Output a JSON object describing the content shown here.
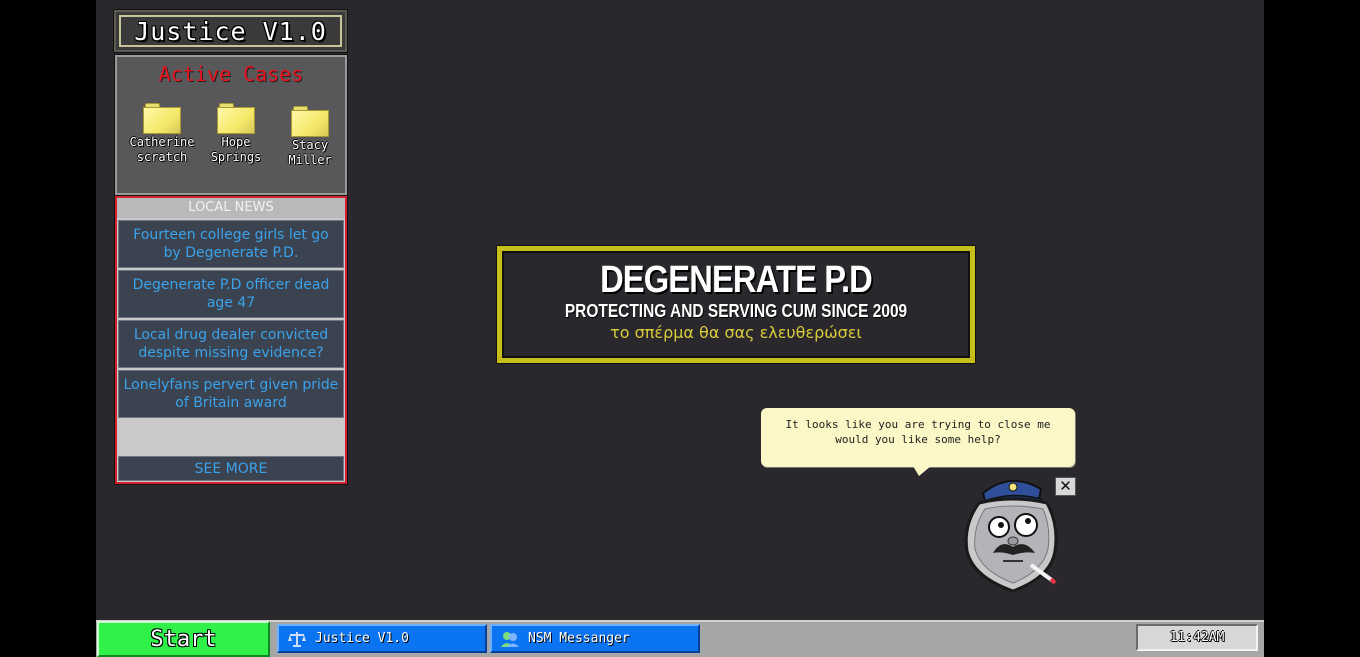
{
  "app": {
    "title": "Justice V1.0"
  },
  "cases": {
    "title": "Active Cases",
    "items": [
      {
        "name": "Catherine scratch"
      },
      {
        "name": "Hope Springs"
      },
      {
        "name": "Stacy Miller"
      }
    ]
  },
  "news": {
    "header": "LOCAL NEWS",
    "items": [
      "Fourteen college girls let go by Degenerate P.D.",
      "Degenerate P.D officer dead age 47",
      "Local drug dealer convicted despite missing evidence?",
      "Lonelyfans pervert given pride of Britain award"
    ],
    "see_more": "SEE MORE"
  },
  "banner": {
    "title": "DEGENERATE P.D",
    "subtitle": "PROTECTING AND SERVING CUM SINCE 2009",
    "motto": "το σπέρμα θα σας ελευθερώσει"
  },
  "assistant": {
    "message": "It looks like you are trying to close me would you like some help?",
    "close_glyph": "✕"
  },
  "taskbar": {
    "start": "Start",
    "tasks": [
      {
        "label": "Justice V1.0",
        "icon": "scales-icon"
      },
      {
        "label": "NSM Messanger",
        "icon": "messenger-users-icon"
      }
    ],
    "clock": "11:42AM"
  },
  "colors": {
    "desktop": "#2a282c",
    "start": "#30f14a",
    "task": "#0a74f2",
    "news_link": "#3aa2ea",
    "accent_red": "#e8141e",
    "banner_border": "#c6bf19"
  }
}
